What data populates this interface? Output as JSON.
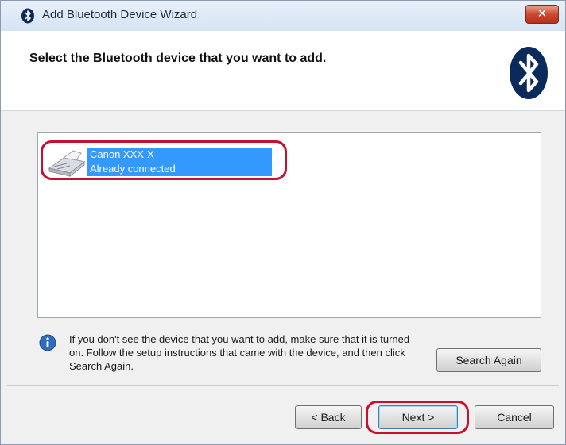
{
  "window": {
    "title": "Add Bluetooth Device Wizard",
    "close_label": "✕"
  },
  "header": {
    "instruction": "Select the Bluetooth device that you want to add."
  },
  "devices": [
    {
      "name": "Canon XXX-X",
      "status": "Already connected"
    }
  ],
  "info": {
    "text": "If you don't see the device that you want to add, make sure that it is turned on. Follow the setup instructions that came with the device, and then click Search Again."
  },
  "buttons": {
    "search_again": "Search Again",
    "back": "< Back",
    "next": "Next >",
    "cancel": "Cancel"
  },
  "colors": {
    "selection": "#3399ff",
    "highlight_outline": "#c8102e",
    "bluetooth_brand": "#0b2a5c"
  }
}
